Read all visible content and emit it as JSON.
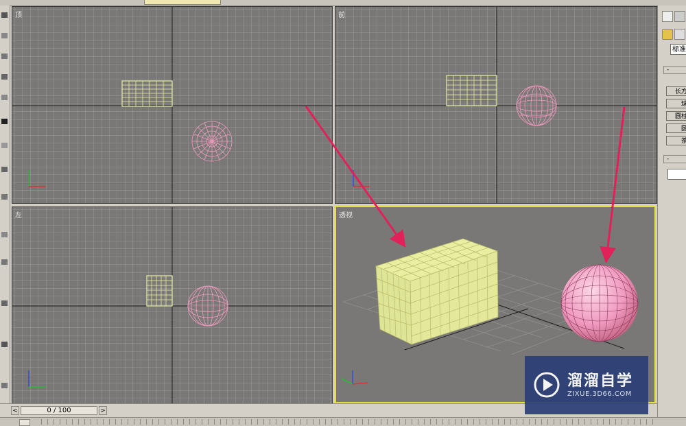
{
  "viewports": {
    "top": {
      "label": "顶"
    },
    "front": {
      "label": "前"
    },
    "left": {
      "label": "左"
    },
    "perspective": {
      "label": "透视"
    }
  },
  "command_panel": {
    "dropdown_value": "标准",
    "object_buttons": [
      "长方",
      "球",
      "圆柱",
      "圆",
      "茶"
    ]
  },
  "timeline": {
    "frame_display": "0 / 100",
    "prev_label": "<",
    "next_label": ">"
  },
  "watermark": {
    "title": "溜溜自学",
    "url": "ZIXUE.3D66.COM"
  },
  "colors": {
    "viewport_bg": "#7a7876",
    "grid": "#9a9896",
    "box": "#e9eea0",
    "sphere": "#f19ac0",
    "arrow": "#e0215a",
    "active_border": "#e6e13a",
    "watermark_bg": "#2b3f77"
  },
  "icons": [
    "select-icon",
    "pointer-icon",
    "sphere-material-icon",
    "undo-icon"
  ]
}
